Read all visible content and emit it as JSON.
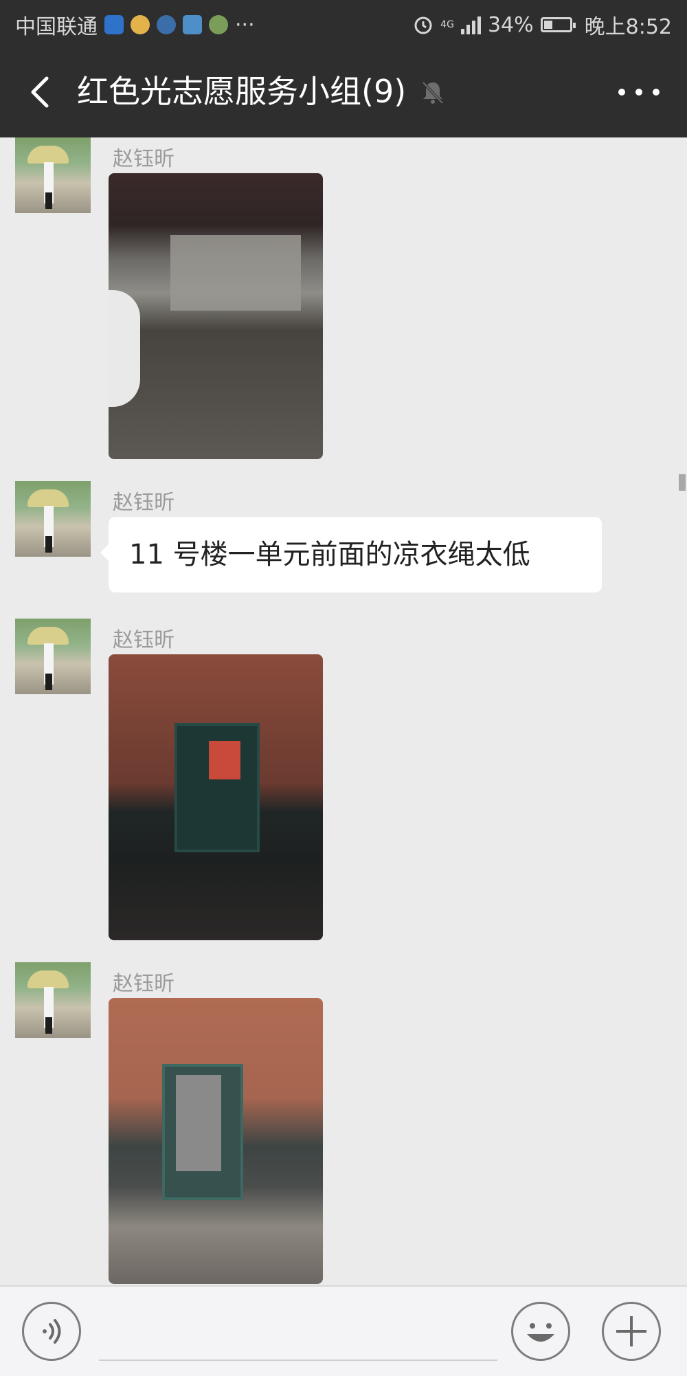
{
  "status_bar": {
    "carrier": "中国联通",
    "extra_dots": "···",
    "network": "4G",
    "battery": "34%",
    "time": "晚上8:52"
  },
  "header": {
    "title": "红色光志愿服务小组(9)"
  },
  "messages": [
    {
      "sender": "赵钰昕",
      "type": "image"
    },
    {
      "sender": "赵钰昕",
      "type": "text",
      "text": "11 号楼一单元前面的凉衣绳太低"
    },
    {
      "sender": "赵钰昕",
      "type": "image"
    },
    {
      "sender": "赵钰昕",
      "type": "image"
    }
  ],
  "input_bar": {
    "placeholder": ""
  },
  "icons": {
    "back": "back-arrow-icon",
    "mute": "bell-muted-icon",
    "more": "more-icon",
    "voice": "voice-icon",
    "emoji": "emoji-icon",
    "plus": "plus-icon"
  },
  "colors": {
    "header_bg": "#2e2e2e",
    "chat_bg": "#ebebeb",
    "bubble_bg": "#ffffff"
  }
}
